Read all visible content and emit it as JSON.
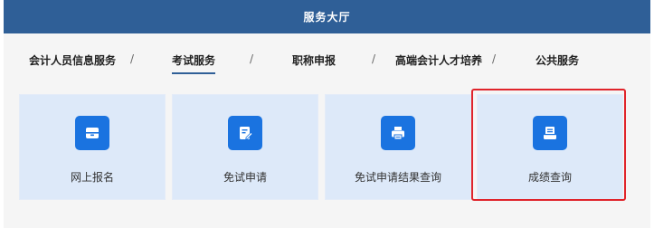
{
  "header": {
    "title": "服务大厅"
  },
  "tabs": [
    {
      "label": "会计人员信息服务",
      "active": false
    },
    {
      "label": "考试服务",
      "active": true
    },
    {
      "label": "职称申报",
      "active": false
    },
    {
      "label": "高端会计人才培养",
      "active": false
    },
    {
      "label": "公共服务",
      "active": false
    }
  ],
  "tab_separator": "/",
  "cards": [
    {
      "label": "网上报名",
      "icon": "inbox-icon"
    },
    {
      "label": "免试申请",
      "icon": "edit-document-icon"
    },
    {
      "label": "免试申请结果查询",
      "icon": "printer-icon"
    },
    {
      "label": "成绩查询",
      "icon": "document-query-icon",
      "highlighted": true
    }
  ],
  "colors": {
    "header_bg": "#2f5f97",
    "card_bg": "#dde9f9",
    "icon_bg": "#1a73e0",
    "highlight": "#e0242b"
  }
}
